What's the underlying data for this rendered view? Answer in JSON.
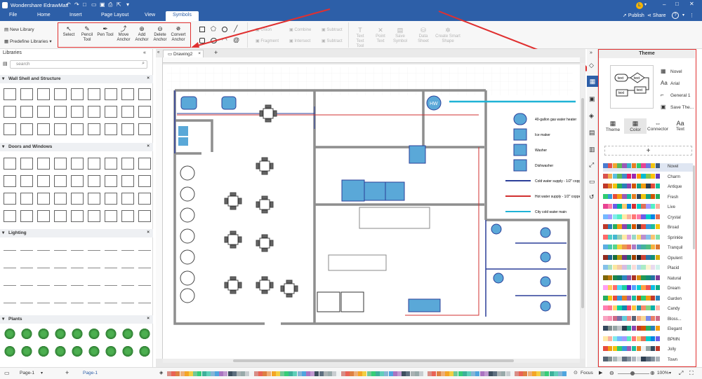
{
  "app": {
    "title": "Wondershare EdrawMax",
    "user_initial": "L",
    "publish": "Publish",
    "share": "Share",
    "help": "?"
  },
  "menu": [
    "File",
    "Home",
    "Insert",
    "Page Layout",
    "View",
    "Symbols"
  ],
  "ribbon": {
    "new_library": "New Library",
    "predefine_libraries": "Predefine Libraries",
    "tools": [
      {
        "icon": "cursor-icon",
        "label": "Select",
        "glyph": "↖"
      },
      {
        "icon": "pencil-icon",
        "label": "Pencil Tool",
        "glyph": "✎"
      },
      {
        "icon": "pen-icon",
        "label": "Pen Tool",
        "glyph": "✒"
      },
      {
        "icon": "move-anchor-icon",
        "label": "Move Anchor",
        "glyph": "⤴"
      },
      {
        "icon": "add-anchor-icon",
        "label": "Add Anchor",
        "glyph": "⊕"
      },
      {
        "icon": "delete-anchor-icon",
        "label": "Delete Anchor",
        "glyph": "⊖"
      },
      {
        "icon": "convert-anchor-icon",
        "label": "Convert Anchor",
        "glyph": "✵"
      }
    ],
    "bool_ops": [
      "Union",
      "Combine",
      "Subtract",
      "Fragment",
      "Intersect",
      "Subtract"
    ],
    "disabled": [
      "Text",
      "Text Tool",
      "Point Text",
      "Save Symbol",
      "Data Sheet",
      "Create Smart Shape"
    ]
  },
  "sidebar": {
    "title": "Libraries",
    "search_placeholder": "search",
    "sections": [
      "Wall Shell and Structure",
      "Doors and Windows",
      "Lighting",
      "Plants"
    ]
  },
  "canvas": {
    "tab": "Drawing2",
    "legend": [
      {
        "label": "40-gallon gas water heater"
      },
      {
        "label": "Ice maker"
      },
      {
        "label": "Washer"
      },
      {
        "label": "Dishwasher"
      },
      {
        "label": "Cold water supply - 1/2\" copper piping",
        "color": "#2b3f99"
      },
      {
        "label": "Hot water supply - 1/2\" copper piping",
        "color": "#d23030"
      },
      {
        "label": "City cold water main",
        "color": "#1fb3d6"
      }
    ],
    "heater_label": "HW"
  },
  "theme_panel": {
    "title": "Theme",
    "options": [
      {
        "icon": "font-style-icon",
        "label": "Novel"
      },
      {
        "icon": "text-icon",
        "label": "Arial"
      },
      {
        "icon": "connector-style-icon",
        "label": "General 1"
      },
      {
        "icon": "save-icon",
        "label": "Save The..."
      }
    ],
    "tabs": [
      "Theme",
      "Color",
      "Connector",
      "Text"
    ],
    "preview_labels": [
      "text",
      "text",
      "text",
      "text"
    ],
    "themes": [
      {
        "name": "Novel",
        "colors": [
          "#4a7bd0",
          "#e35050",
          "#f0a630",
          "#5bb85d",
          "#9b59b6",
          "#38b2c9",
          "#e67e22",
          "#2ecc71",
          "#e84393",
          "#6c7ae0",
          "#f1c40f",
          "#3d5a80"
        ]
      },
      {
        "name": "Charm",
        "colors": [
          "#d9534f",
          "#f0ad4e",
          "#5bc0de",
          "#5cb85c",
          "#428bca",
          "#e91e63",
          "#9c27b0",
          "#ff9800",
          "#00bcd4",
          "#8bc34a",
          "#ffc107",
          "#673ab7"
        ]
      },
      {
        "name": "Antique",
        "colors": [
          "#c0392b",
          "#e67e22",
          "#f1c40f",
          "#27ae60",
          "#2980b9",
          "#8e44ad",
          "#d35400",
          "#16a085",
          "#f39c12",
          "#2c3e50",
          "#e74c3c",
          "#1abc9c"
        ]
      },
      {
        "name": "Fresh",
        "colors": [
          "#2ecc71",
          "#3498db",
          "#e74c3c",
          "#f39c12",
          "#9b59b6",
          "#1abc9c",
          "#e67e22",
          "#34495e",
          "#f1c40f",
          "#16a085",
          "#d35400",
          "#27ae60"
        ]
      },
      {
        "name": "Live",
        "colors": [
          "#e84393",
          "#fd79a8",
          "#6c5ce7",
          "#00b894",
          "#fdcb6e",
          "#0984e3",
          "#d63031",
          "#00cec9",
          "#e17055",
          "#a29bfe",
          "#55efc4",
          "#fab1a0"
        ]
      },
      {
        "name": "Crystal",
        "colors": [
          "#74b9ff",
          "#a29bfe",
          "#81ecec",
          "#55efc4",
          "#ffeaa7",
          "#fab1a0",
          "#ff7675",
          "#fd79a8",
          "#6c5ce7",
          "#00cec9",
          "#0984e3",
          "#e17055"
        ]
      },
      {
        "name": "Broad",
        "colors": [
          "#c0392b",
          "#2980b9",
          "#27ae60",
          "#f39c12",
          "#8e44ad",
          "#16a085",
          "#d35400",
          "#2c3e50",
          "#e74c3c",
          "#3498db",
          "#1abc9c",
          "#f1c40f"
        ]
      },
      {
        "name": "Sprinkle",
        "colors": [
          "#ff6b6b",
          "#4ecdc4",
          "#45b7d1",
          "#96ceb4",
          "#ffeaa7",
          "#dda0dd",
          "#98d8c8",
          "#f7dc6f",
          "#bb8fce",
          "#85c1e9",
          "#f8c471",
          "#82e0aa"
        ]
      },
      {
        "name": "Tranquil",
        "colors": [
          "#5dade2",
          "#48c9b0",
          "#58d68d",
          "#f4d03f",
          "#eb984e",
          "#ec7063",
          "#af7ac5",
          "#5499c7",
          "#45b39d",
          "#52be80",
          "#f5b041",
          "#dc7633"
        ]
      },
      {
        "name": "Opulent",
        "colors": [
          "#922b21",
          "#1f618d",
          "#196f3d",
          "#b7950b",
          "#6c3483",
          "#117864",
          "#a04000",
          "#1b2631",
          "#cb4335",
          "#2874a6",
          "#148f77",
          "#d4ac0d"
        ]
      },
      {
        "name": "Placid",
        "colors": [
          "#85c1e9",
          "#a9dfbf",
          "#f9e79f",
          "#f5cba7",
          "#d7bde2",
          "#a3e4d7",
          "#fadbd8",
          "#aed6f1",
          "#abebc6",
          "#fcf3cf",
          "#e8daef",
          "#d1f2eb"
        ]
      },
      {
        "name": "Natural",
        "colors": [
          "#7d6608",
          "#b9770e",
          "#1e8449",
          "#117a65",
          "#2e86c1",
          "#884ea0",
          "#a93226",
          "#d68910",
          "#229954",
          "#138d75",
          "#2471a3",
          "#7d3c98"
        ]
      },
      {
        "name": "Dream",
        "colors": [
          "#ff9ff3",
          "#feca57",
          "#ff6b6b",
          "#48dbfb",
          "#1dd1a1",
          "#5f27cd",
          "#54a0ff",
          "#00d2d3",
          "#ff9f43",
          "#ee5253",
          "#0abde3",
          "#10ac84"
        ]
      },
      {
        "name": "Garden",
        "colors": [
          "#27ae60",
          "#f1c40f",
          "#e74c3c",
          "#3498db",
          "#e67e22",
          "#9b59b6",
          "#1abc9c",
          "#d35400",
          "#2ecc71",
          "#f39c12",
          "#c0392b",
          "#2980b9"
        ]
      },
      {
        "name": "Candy",
        "colors": [
          "#ff7eb3",
          "#ff758f",
          "#ffd166",
          "#06d6a0",
          "#118ab2",
          "#ef476f",
          "#ffc43d",
          "#1b9aaa",
          "#f78c6b",
          "#83d483",
          "#0cb0a9",
          "#ffb5a7"
        ]
      },
      {
        "name": "Bloss...",
        "colors": [
          "#f8a5c2",
          "#f78fb3",
          "#cf6a87",
          "#786fa6",
          "#63cdda",
          "#ea8685",
          "#596275",
          "#f3a683",
          "#f7d794",
          "#778beb",
          "#e77f67",
          "#cf6a87"
        ]
      },
      {
        "name": "Elegant",
        "colors": [
          "#34495e",
          "#7f8c8d",
          "#95a5a6",
          "#bdc3c7",
          "#2c3e50",
          "#16a085",
          "#8e44ad",
          "#c0392b",
          "#d35400",
          "#27ae60",
          "#2980b9",
          "#f39c12"
        ]
      },
      {
        "name": "BPMN",
        "colors": [
          "#ffeaa7",
          "#fab1a0",
          "#81ecec",
          "#74b9ff",
          "#a29bfe",
          "#55efc4",
          "#ff7675",
          "#fdcb6e",
          "#e17055",
          "#00cec9",
          "#0984e3",
          "#6c5ce7"
        ]
      },
      {
        "name": "Jolly",
        "colors": [
          "#e74c3c",
          "#f39c12",
          "#f1c40f",
          "#2ecc71",
          "#3498db",
          "#9b59b6",
          "#1abc9c",
          "#e67e22",
          "#ecf0f1",
          "#95a5a6",
          "#34495e",
          "#c0392b"
        ]
      },
      {
        "name": "Town",
        "colors": [
          "#566573",
          "#839192",
          "#aab7b8",
          "#d5dbdb",
          "#5d6d7e",
          "#85929e",
          "#aeb6bf",
          "#d6dbdf",
          "#2e4053",
          "#5d6d7e",
          "#85929e",
          "#abb2b9"
        ]
      }
    ]
  },
  "status": {
    "page_left": "Page-1",
    "page_tab": "Page-1",
    "focus": "Focus",
    "zoom": "100%"
  },
  "colors": {
    "accent": "#2d5fa8",
    "highlight": "#e03030",
    "cold": "#2b3f99",
    "hot": "#d23030",
    "city": "#1fb3d6",
    "fixture": "#5aa8d8"
  }
}
